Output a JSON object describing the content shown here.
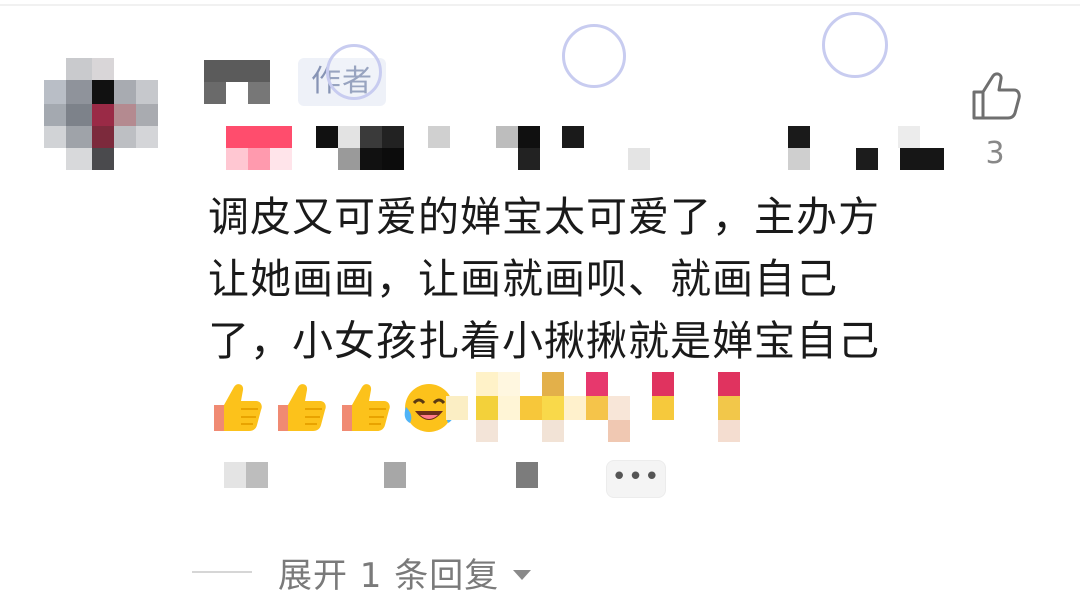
{
  "comment": {
    "author_badge": "作者",
    "like_count": "3",
    "body": "调皮又可爱的婵宝太可爱了，主办方\n让她画画，让画就画呗、就画自己\n了，小女孩扎着小揪揪就是婵宝自己",
    "emojis": [
      "thumbs-up",
      "thumbs-up",
      "thumbs-up",
      "laughing-tears"
    ],
    "more_label": "•••"
  },
  "replies": {
    "label": "展开 1 条回复"
  },
  "colors": {
    "badge_bg": "#eef1f8",
    "badge_text": "#8794b5",
    "body_text": "#1a1a1a",
    "muted_text": "#7a7a7a"
  }
}
